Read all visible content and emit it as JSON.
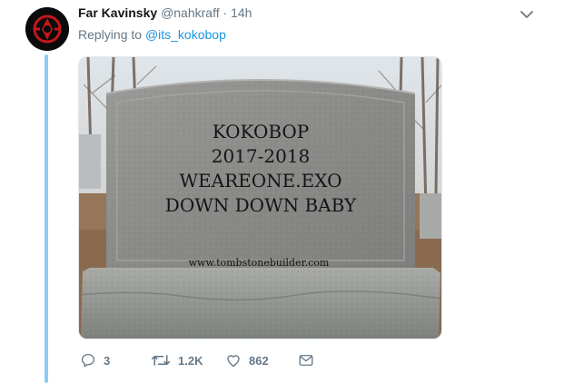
{
  "tweet": {
    "author_name": "Far Kavinsky",
    "handle": "@nahkraff",
    "separator": "·",
    "time": "14h",
    "replying_prefix": "Replying to",
    "replying_to": "@its_kokobop",
    "image": {
      "lines": [
        "KOKOBOP",
        "2017-2018",
        "WEAREONE.EXO",
        "DOWN DOWN BABY"
      ],
      "footer": "www.tombstonebuilder.com"
    },
    "actions": {
      "reply_count": "3",
      "retweet_count": "1.2K",
      "like_count": "862"
    }
  },
  "icons": {
    "avatar": "red-emblem-avatar",
    "caret": "chevron-down-icon",
    "reply": "reply-bubble-icon",
    "retweet": "retweet-icon",
    "like": "heart-icon",
    "dm": "envelope-icon"
  },
  "colors": {
    "thread_line": "#8ecbf2",
    "link": "#1b95e0",
    "muted": "#657786",
    "stone": "#8e8e8c"
  }
}
